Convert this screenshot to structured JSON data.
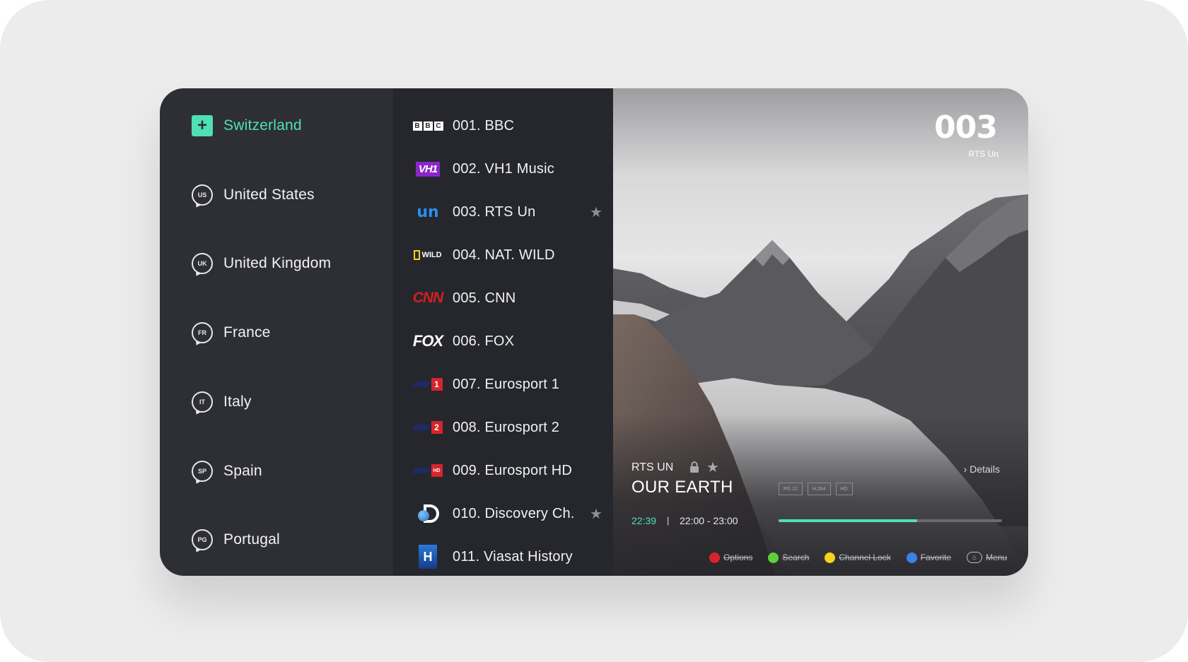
{
  "colors": {
    "accent": "#4fe0b6",
    "panel": "#2e2f35",
    "list": "#26272c"
  },
  "countries": [
    {
      "code": "+",
      "label": "Switzerland",
      "active": true
    },
    {
      "code": "US",
      "label": "United States"
    },
    {
      "code": "UK",
      "label": "United Kingdom"
    },
    {
      "code": "FR",
      "label": "France"
    },
    {
      "code": "IT",
      "label": "Italy"
    },
    {
      "code": "SP",
      "label": "Spain"
    },
    {
      "code": "PG",
      "label": "Portugal"
    }
  ],
  "channels": [
    {
      "name": "001. BBC",
      "logo": "bbc",
      "favorite": false
    },
    {
      "name": "002. VH1 Music",
      "logo": "vh1",
      "favorite": false
    },
    {
      "name": "003. RTS Un",
      "logo": "rts",
      "favorite": true
    },
    {
      "name": "004. NAT. WILD",
      "logo": "natwild",
      "favorite": false
    },
    {
      "name": "005. CNN",
      "logo": "cnn",
      "favorite": false
    },
    {
      "name": "006. FOX",
      "logo": "fox",
      "favorite": false
    },
    {
      "name": "007. Eurosport 1",
      "logo": "eurosport",
      "favorite": false
    },
    {
      "name": "008. Eurosport 2",
      "logo": "eurosport",
      "favorite": false
    },
    {
      "name": "009. Eurosport HD",
      "logo": "eurosport",
      "favorite": false
    },
    {
      "name": "010. Discovery Ch.",
      "logo": "discovery",
      "favorite": true
    },
    {
      "name": "011. Viasat History",
      "logo": "viasat",
      "favorite": false
    }
  ],
  "logo_text": {
    "bbc": [
      "B",
      "B",
      "C"
    ],
    "vh1": "VH1",
    "rts": "un",
    "natwild": "WILD",
    "cnn": "CNN",
    "fox": "FOX",
    "euro_1": "1",
    "euro_2": "2",
    "euro_hd": "HD",
    "viasat": "H"
  },
  "preview": {
    "channel_number": "003",
    "channel_name": "RTS Un",
    "program_channel": "RTS UN",
    "program_title": "OUR EARTH",
    "details_label": "Details",
    "tags": [
      "PG 12",
      "H.264",
      "HD"
    ],
    "current_time": "22:39",
    "separator": "|",
    "time_slot": "22:00 - 23:00",
    "progress": 0.62
  },
  "keys": [
    {
      "label": "Options",
      "color": "#d7242c",
      "icon": "red-dot"
    },
    {
      "label": "Search",
      "color": "#5fcf3c",
      "icon": "green-dot"
    },
    {
      "label": "Channel Lock",
      "color": "#f5d21c",
      "icon": "yellow-dot"
    },
    {
      "label": "Favorite",
      "color": "#3b82e8",
      "icon": "blue-dot"
    },
    {
      "label": "Menu",
      "color": "",
      "icon": "home-icon"
    }
  ]
}
